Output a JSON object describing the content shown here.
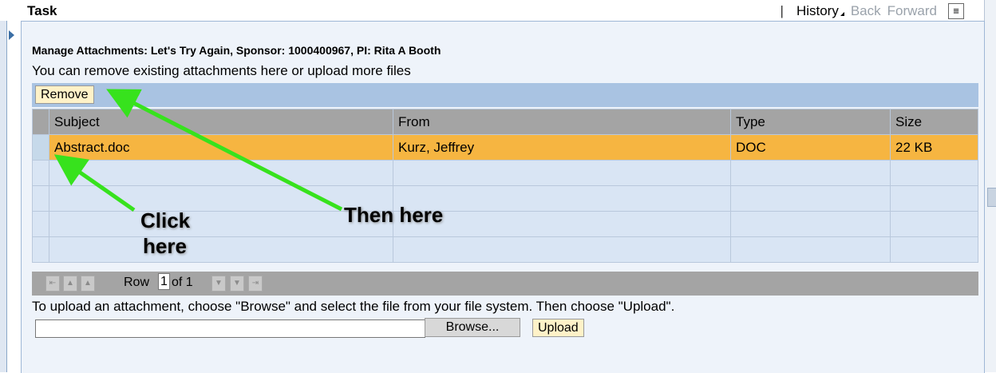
{
  "header": {
    "title": "Task",
    "separator": "|",
    "history": "History",
    "back": "Back",
    "forward": "Forward",
    "menu_icon": "list-icon"
  },
  "content": {
    "title": "Manage Attachments: Let's Try Again, Sponsor: 1000400967, PI: Rita A Booth",
    "subtitle": "You can remove existing attachments here or upload more files",
    "remove_label": "Remove"
  },
  "table": {
    "columns": [
      "Subject",
      "From",
      "Type",
      "Size"
    ],
    "rows": [
      {
        "subject": "Abstract.doc",
        "from": "Kurz, Jeffrey",
        "type": "DOC",
        "size": "22 KB"
      }
    ]
  },
  "pager": {
    "row_label": "Row",
    "row_value": "1",
    "of_label": "of 1"
  },
  "upload": {
    "hint": "To upload an attachment, choose \"Browse\" and select the file from your file system. Then choose \"Upload\".",
    "file_value": "",
    "browse_label": "Browse...",
    "upload_label": "Upload"
  },
  "annotations": {
    "click_line1": "Click",
    "click_line2": "here",
    "then_here": "Then here"
  },
  "colors": {
    "accent": "#a9c3e2",
    "selected_row": "#f6b541",
    "annotation_arrow": "#37e21d"
  }
}
